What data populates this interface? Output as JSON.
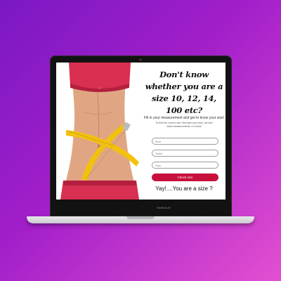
{
  "device": {
    "brand_label": "MacBook Air"
  },
  "page": {
    "heading": "Don't know whether you are a size 10, 12, 14, 100 etc?",
    "subheading": "Fill in your measurement and get to know your size!",
    "helper_text": "To find the correct size, first take your bust, hip and waist measurements, in inches",
    "fields": [
      {
        "placeholder": "Bust"
      },
      {
        "placeholder": "Waist"
      },
      {
        "placeholder": "Hips"
      }
    ],
    "button_label": "Check size",
    "result_text": "Yay!....You are a size ?"
  },
  "colors": {
    "accent": "#c8103c",
    "background_start": "#7a18c4",
    "background_end": "#e24fd0"
  }
}
